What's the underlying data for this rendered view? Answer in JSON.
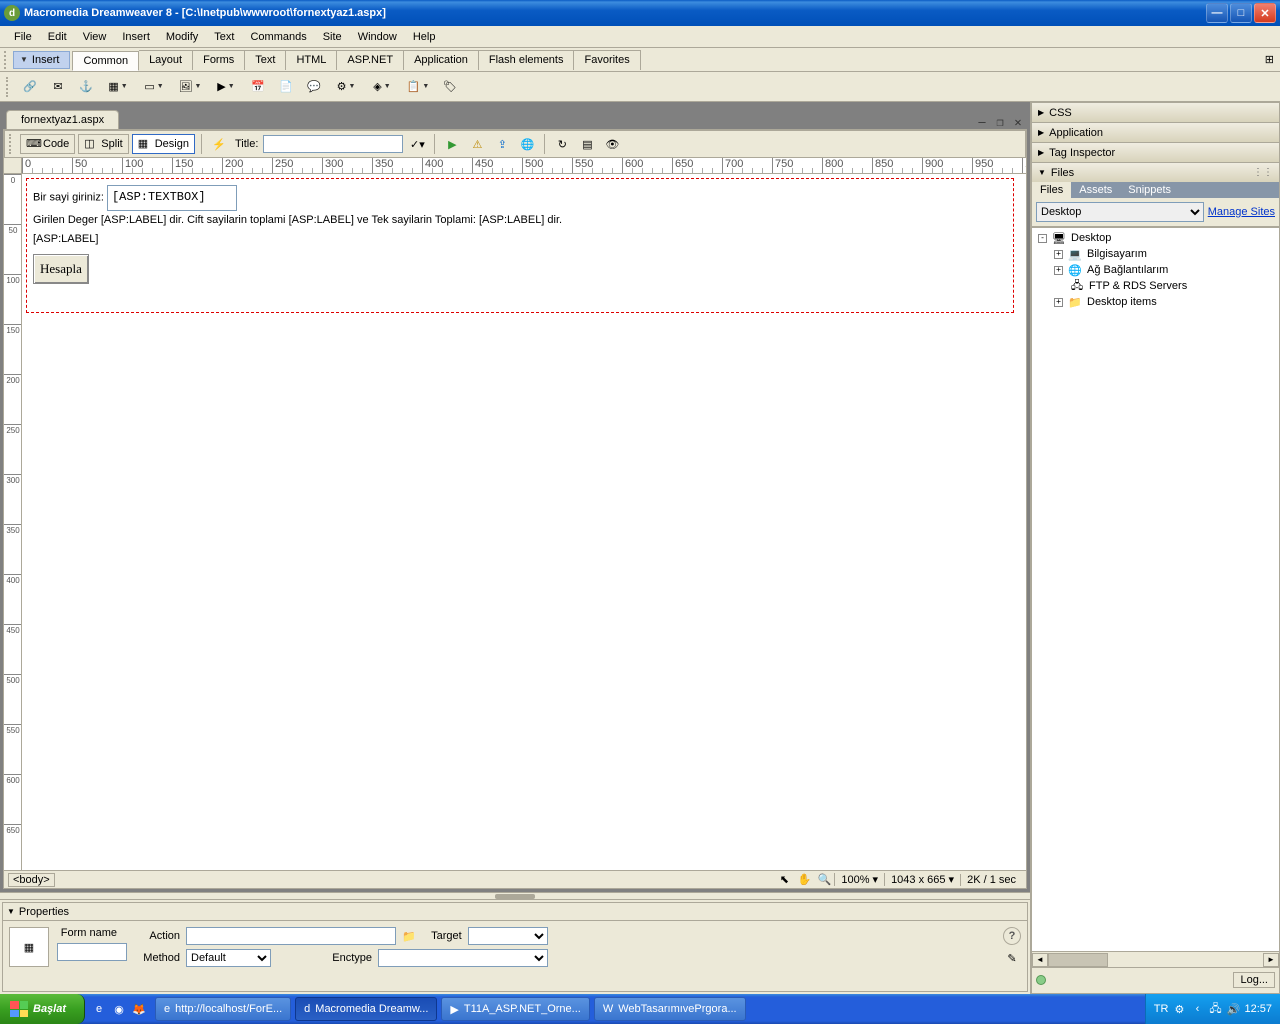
{
  "titlebar": {
    "title": "Macromedia Dreamweaver 8 - [C:\\Inetpub\\wwwroot\\fornextyaz1.aspx]"
  },
  "menubar": [
    "File",
    "Edit",
    "View",
    "Insert",
    "Modify",
    "Text",
    "Commands",
    "Site",
    "Window",
    "Help"
  ],
  "insert": {
    "label": "Insert",
    "tabs": [
      "Common",
      "Layout",
      "Forms",
      "Text",
      "HTML",
      "ASP.NET",
      "Application",
      "Flash elements",
      "Favorites"
    ],
    "active": 0
  },
  "doc": {
    "tab": "fornextyaz1.aspx",
    "views": {
      "code": "Code",
      "split": "Split",
      "design": "Design",
      "active": "design"
    },
    "title_label": "Title:",
    "title_value": "",
    "content": {
      "label1": "Bir sayi giriniz:",
      "textbox": "[ASP:TEXTBOX]",
      "line2_a": "Girilen Deger ",
      "line2_b": "[ASP:LABEL]",
      "line2_c": " dir. Cift sayilarin toplami ",
      "line2_d": "[ASP:LABEL]",
      "line2_e": " ve Tek sayilarin Toplami: ",
      "line2_f": "[ASP:LABEL]",
      "line2_g": " dir.",
      "line3": "[ASP:LABEL]",
      "button": "Hesapla"
    },
    "status": {
      "tag_path": "<body>",
      "zoom": "100%",
      "dimensions": "1043 x 665",
      "size_time": "2K / 1 sec"
    }
  },
  "properties": {
    "title": "Properties",
    "form_name_label": "Form name",
    "form_name": "",
    "action_label": "Action",
    "action": "",
    "method_label": "Method",
    "method": "Default",
    "target_label": "Target",
    "target": "",
    "enctype_label": "Enctype",
    "enctype": ""
  },
  "right_panels": {
    "css": "CSS",
    "application": "Application",
    "tag_inspector": "Tag Inspector",
    "files": {
      "title": "Files",
      "tabs": [
        "Files",
        "Assets",
        "Snippets"
      ],
      "active": 0,
      "dropdown": "Desktop",
      "manage": "Manage Sites",
      "tree": [
        {
          "level": 0,
          "exp": "-",
          "icon": "desktop",
          "label": "Desktop"
        },
        {
          "level": 1,
          "exp": "+",
          "icon": "computer",
          "label": "Bilgisayarım"
        },
        {
          "level": 1,
          "exp": "+",
          "icon": "network",
          "label": "Ağ Bağlantılarım"
        },
        {
          "level": 1,
          "exp": "",
          "icon": "ftp",
          "label": "FTP & RDS Servers"
        },
        {
          "level": 1,
          "exp": "+",
          "icon": "folder",
          "label": "Desktop items"
        }
      ],
      "log": "Log..."
    }
  },
  "taskbar": {
    "start": "Başlat",
    "tasks": [
      {
        "icon": "ie",
        "label": "http://localhost/ForE..."
      },
      {
        "icon": "dw",
        "label": "Macromedia Dreamw...",
        "active": true
      },
      {
        "icon": "vs",
        "label": "T11A_ASP.NET_Orne..."
      },
      {
        "icon": "word",
        "label": "WebTasarımıvePrgora..."
      }
    ],
    "tray": {
      "lang": "TR",
      "time": "12:57"
    }
  }
}
